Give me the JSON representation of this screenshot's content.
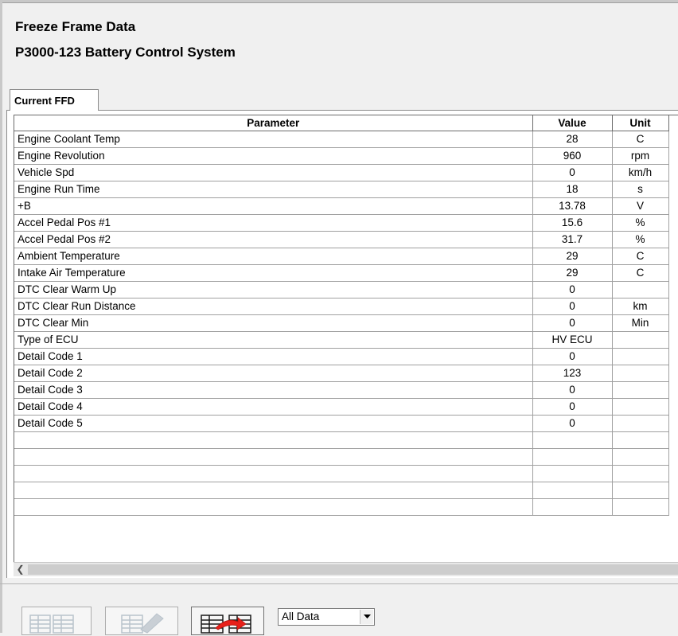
{
  "header": {
    "title": "Freeze Frame Data",
    "subtitle": "P3000-123 Battery Control System"
  },
  "tabs": [
    {
      "label": "Current FFD",
      "selected": true
    }
  ],
  "table": {
    "columns": [
      "Parameter",
      "Value",
      "Unit"
    ],
    "rows": [
      {
        "parameter": "Engine Coolant Temp",
        "value": "28",
        "unit": "C"
      },
      {
        "parameter": "Engine Revolution",
        "value": "960",
        "unit": "rpm"
      },
      {
        "parameter": "Vehicle Spd",
        "value": "0",
        "unit": "km/h"
      },
      {
        "parameter": "Engine Run Time",
        "value": "18",
        "unit": "s"
      },
      {
        "parameter": "+B",
        "value": "13.78",
        "unit": "V"
      },
      {
        "parameter": "Accel Pedal Pos #1",
        "value": "15.6",
        "unit": "%"
      },
      {
        "parameter": "Accel Pedal Pos #2",
        "value": "31.7",
        "unit": "%"
      },
      {
        "parameter": "Ambient Temperature",
        "value": "29",
        "unit": "C"
      },
      {
        "parameter": "Intake Air Temperature",
        "value": "29",
        "unit": "C"
      },
      {
        "parameter": "DTC Clear Warm Up",
        "value": "0",
        "unit": ""
      },
      {
        "parameter": "DTC Clear Run Distance",
        "value": "0",
        "unit": "km"
      },
      {
        "parameter": "DTC Clear Min",
        "value": "0",
        "unit": "Min"
      },
      {
        "parameter": "Type of ECU",
        "value": "HV ECU",
        "unit": ""
      },
      {
        "parameter": "Detail Code 1",
        "value": "0",
        "unit": ""
      },
      {
        "parameter": "Detail Code 2",
        "value": "123",
        "unit": ""
      },
      {
        "parameter": "Detail Code 3",
        "value": "0",
        "unit": ""
      },
      {
        "parameter": "Detail Code 4",
        "value": "0",
        "unit": ""
      },
      {
        "parameter": "Detail Code 5",
        "value": "0",
        "unit": ""
      },
      {
        "parameter": "",
        "value": "",
        "unit": ""
      },
      {
        "parameter": "",
        "value": "",
        "unit": ""
      },
      {
        "parameter": "",
        "value": "",
        "unit": ""
      },
      {
        "parameter": "",
        "value": "",
        "unit": ""
      },
      {
        "parameter": "",
        "value": "",
        "unit": ""
      }
    ]
  },
  "scrollbar": {
    "left_arrow_icon": "chevron-left-icon"
  },
  "toolbar": {
    "buttons": [
      {
        "icon": "table-compare-icon",
        "enabled": false
      },
      {
        "icon": "table-graph-icon",
        "enabled": false
      },
      {
        "icon": "table-export-arrow-icon",
        "enabled": true
      }
    ],
    "filter": {
      "selected": "All Data",
      "dropdown_icon": "chevron-down-icon"
    }
  },
  "colors": {
    "export_arrow": "#e8201a",
    "disabled_icon": "#b9c3cc"
  }
}
